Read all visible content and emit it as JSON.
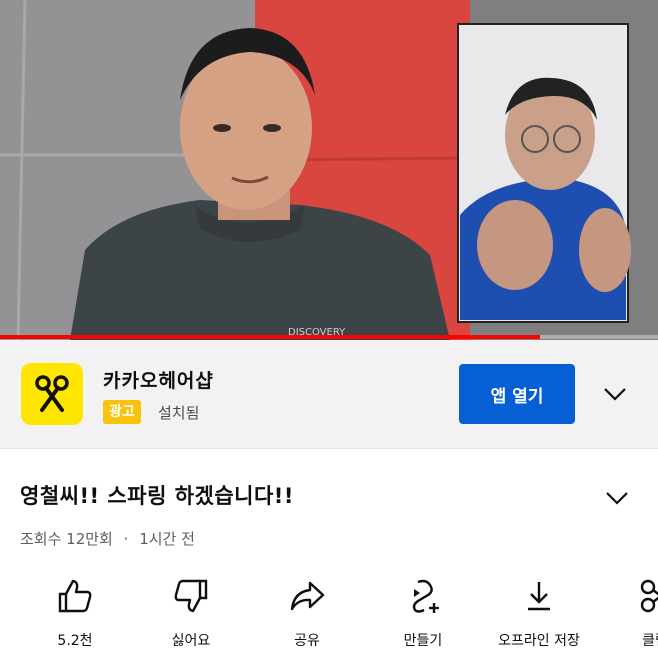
{
  "video": {
    "progress_fraction": 0.82
  },
  "ad": {
    "app_name": "카카오헤어샵",
    "badge": "광고",
    "status": "설치됨",
    "open_button": "앱 열기",
    "logo_icon": "scissors-icon",
    "expand_icon": "chevron-down-icon"
  },
  "video_info": {
    "title": "영철씨!! 스파링 하겠습니다!!",
    "views": "조회수 12만회",
    "separator": "·",
    "age": "1시간 전",
    "expand_icon": "chevron-down-icon"
  },
  "actions": [
    {
      "icon": "thumbs-up-icon",
      "label": "5.2천"
    },
    {
      "icon": "thumbs-down-icon",
      "label": "싫어요"
    },
    {
      "icon": "share-icon",
      "label": "공유"
    },
    {
      "icon": "create-icon",
      "label": "만들기"
    },
    {
      "icon": "download-icon",
      "label": "오프라인 저장"
    },
    {
      "icon": "clip-icon",
      "label": "클립"
    }
  ],
  "colors": {
    "accent_blue": "#065fd4",
    "ad_badge": "#f9c30d",
    "logo_yellow": "#ffe600",
    "progress_red": "#ff0000"
  }
}
